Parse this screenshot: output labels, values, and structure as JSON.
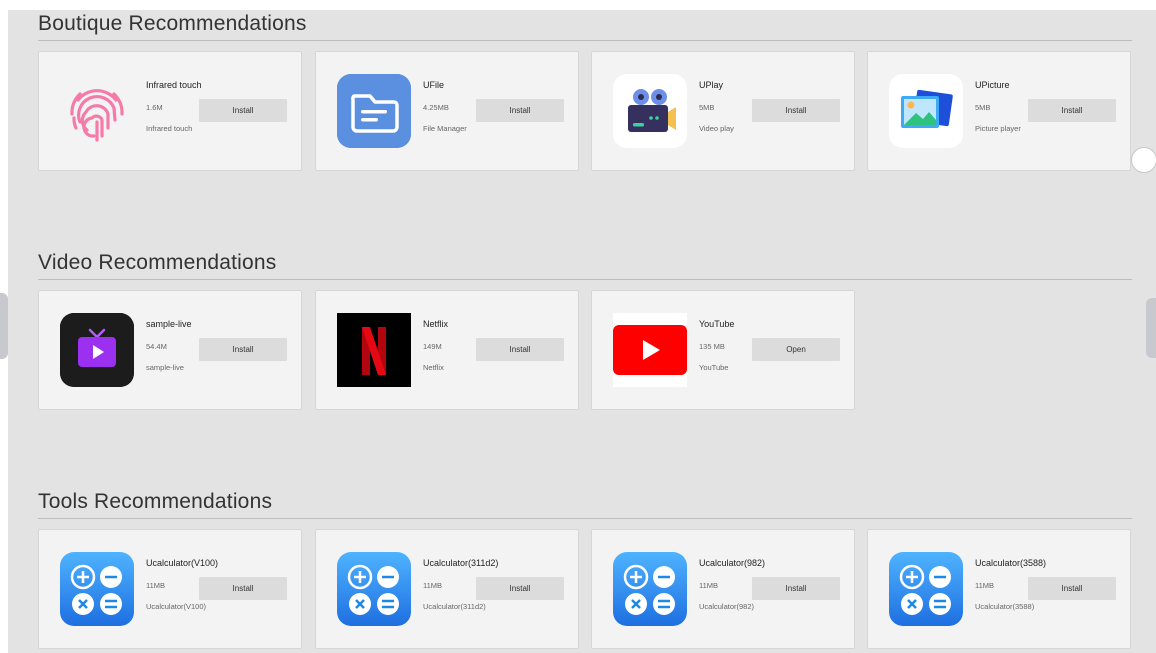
{
  "sections": [
    {
      "title": "Boutique Recommendations",
      "apps": [
        {
          "name": "Infrared touch",
          "size": "1.6M",
          "description": "Infrared touch",
          "action": "Install",
          "icon": "fingerprint-icon"
        },
        {
          "name": "UFile",
          "size": "4.25MB",
          "description": "File Manager",
          "action": "Install",
          "icon": "folder-icon"
        },
        {
          "name": "UPlay",
          "size": "5MB",
          "description": "Video play",
          "action": "Install",
          "icon": "video-camera-icon"
        },
        {
          "name": "UPicture",
          "size": "5MB",
          "description": "Picture player",
          "action": "Install",
          "icon": "photo-gallery-icon"
        }
      ]
    },
    {
      "title": "Video Recommendations",
      "apps": [
        {
          "name": "sample-live",
          "size": "54.4M",
          "description": "sample-live",
          "action": "Install",
          "icon": "tv-play-icon"
        },
        {
          "name": "Netflix",
          "size": "149M",
          "description": "Netflix",
          "action": "Install",
          "icon": "netflix-logo-icon"
        },
        {
          "name": "YouTube",
          "size": "135 MB",
          "description": "YouTube",
          "action": "Open",
          "icon": "youtube-logo-icon"
        }
      ]
    },
    {
      "title": "Tools Recommendations",
      "apps": [
        {
          "name": "Ucalculator(V100)",
          "size": "11MB",
          "description": "Ucalculator(V100)",
          "action": "Install",
          "icon": "calculator-icon"
        },
        {
          "name": "Ucalculator(311d2)",
          "size": "11MB",
          "description": "Ucalculator(311d2)",
          "action": "Install",
          "icon": "calculator-icon"
        },
        {
          "name": "Ucalculator(982)",
          "size": "11MB",
          "description": "Ucalculator(982)",
          "action": "Install",
          "icon": "calculator-icon"
        },
        {
          "name": "Ucalculator(3588)",
          "size": "11MB",
          "description": "Ucalculator(3588)",
          "action": "Install",
          "icon": "calculator-icon"
        }
      ]
    }
  ],
  "colors": {
    "background": "#e3e3e3",
    "card": "#f3f3f3",
    "button": "#dcdcdc",
    "netflix_red": "#e50914",
    "youtube_red": "#ff0000",
    "calculator_blue": "#1e88e5"
  }
}
